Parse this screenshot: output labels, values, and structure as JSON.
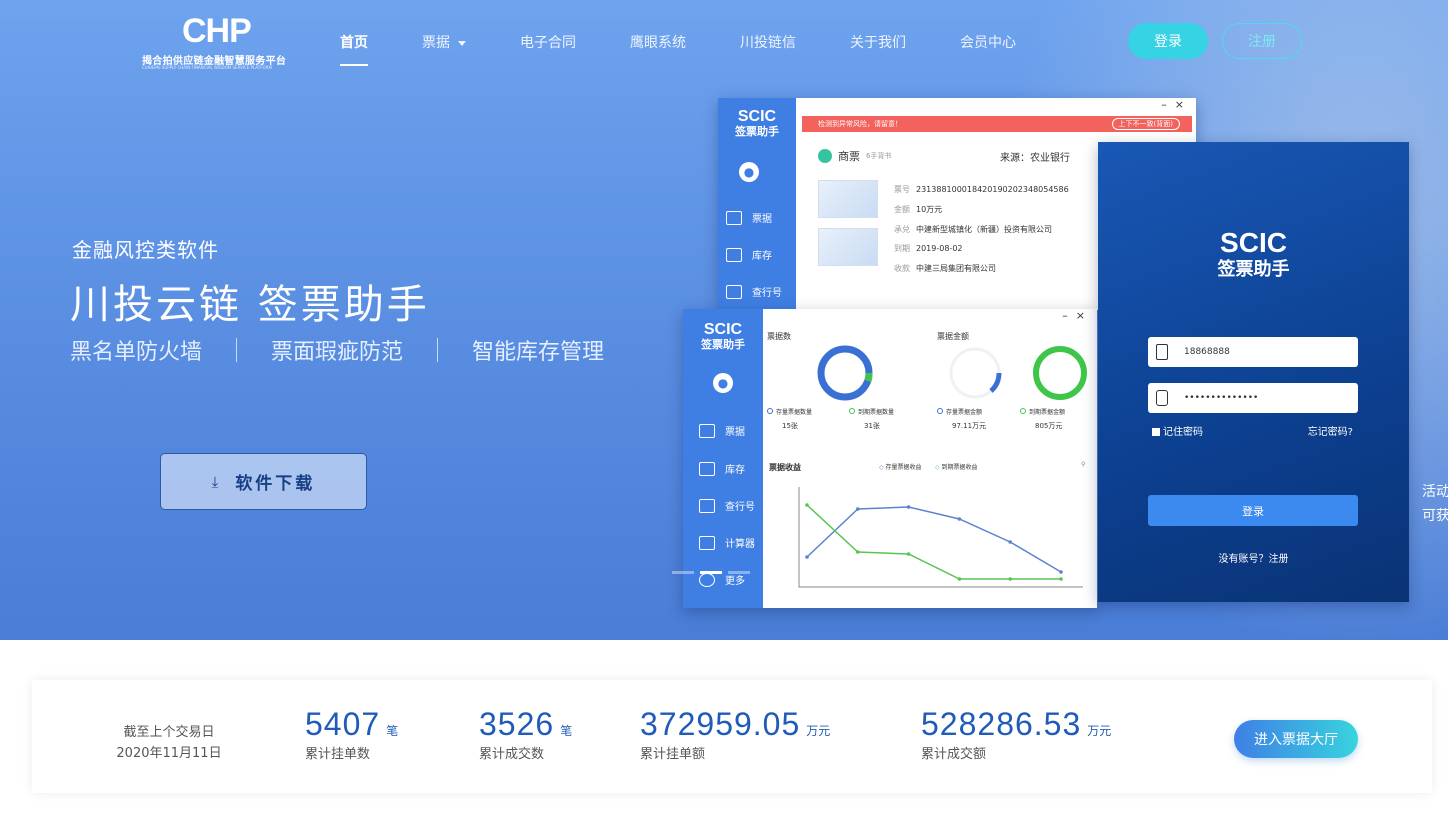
{
  "logo": {
    "mark": "CHP",
    "subtitle": "揭合拍供应链金融智慧服务平台",
    "subtitle_en": "CUIHEPAI SUPPLY CHAIN FINANCIAL WISDOM SERVICE PLATFORM"
  },
  "nav": {
    "items": [
      "首页",
      "票据",
      "电子合同",
      "鹰眼系统",
      "川投链信",
      "关于我们",
      "会员中心"
    ],
    "active": "首页",
    "login": "登录",
    "register": "注册"
  },
  "hero": {
    "subtitle": "金融风控类软件",
    "title": "川投云链  签票助手",
    "features": [
      "黑名单防火墙",
      "票面瑕疵防范",
      "智能库存管理"
    ],
    "download": "软件下载",
    "edge_text": [
      "活动",
      "可获"
    ]
  },
  "app": {
    "brand": "SCIC",
    "brand_sub": "签票助手",
    "win1": {
      "alert": "检测到异常风险，请留意！",
      "alert_right": "上下不一致(背面)",
      "ticket_type": "商票",
      "ticket_note": "6手背书",
      "source": "来源：农业银行",
      "fields": [
        {
          "label": "票号",
          "value": "231388100018420190202348054586"
        },
        {
          "label": "金额",
          "value": "10万元"
        },
        {
          "label": "承兑",
          "value": "中建新型城镇化（新疆）投资有限公司"
        },
        {
          "label": "到期",
          "value": "2019-08-02"
        },
        {
          "label": "收款",
          "value": "中建三局集团有限公司"
        }
      ],
      "menu": [
        "票据",
        "库存",
        "查行号"
      ]
    },
    "win2": {
      "menu": [
        "票据",
        "库存",
        "查行号",
        "计算器",
        "更多"
      ],
      "count_title": "票据数",
      "amount_title": "票据金额",
      "rings": [
        {
          "label": "存量票据数量",
          "value": "15张"
        },
        {
          "label": "到期票据数量",
          "value": "31张"
        },
        {
          "label": "存量票据金额",
          "value": "97.11万元"
        },
        {
          "label": "到期票据金额",
          "value": "805万元"
        }
      ],
      "chart_title": "票据收益",
      "legend": [
        "存量票据收益",
        "到期票据收益"
      ],
      "chart_data": {
        "type": "line",
        "series": [
          {
            "name": "存量票据收益",
            "values": [
              30,
              78,
              80,
              68,
              45,
              15
            ],
            "color": "#5a83d0"
          },
          {
            "name": "到期票据收益",
            "values": [
              82,
              35,
              33,
              8,
              8,
              8
            ],
            "color": "#58c455"
          }
        ],
        "ylim": [
          0,
          100
        ]
      }
    },
    "login": {
      "brand": "SCIC",
      "brand_sub": "签票助手",
      "phone": "18868888",
      "password": "••••••••••••••",
      "remember": "记住密码",
      "forgot": "忘记密码?",
      "button": "登录",
      "register": "没有账号？注册"
    }
  },
  "stats": {
    "asof_label": "截至上个交易日",
    "asof_date": "2020年11月11日",
    "items": [
      {
        "value": "5407",
        "unit": "笔",
        "label": "累计挂单数"
      },
      {
        "value": "3526",
        "unit": "笔",
        "label": "累计成交数"
      },
      {
        "value": "372959.05",
        "unit": "万元",
        "label": "累计挂单额"
      },
      {
        "value": "528286.53",
        "unit": "万元",
        "label": "累计成交额"
      }
    ],
    "hall_button": "进入票据大厅"
  },
  "colors": {
    "accent": "#35d3e4",
    "stat_number": "#1f5bb8",
    "app_blue": "#3f7fe3"
  }
}
